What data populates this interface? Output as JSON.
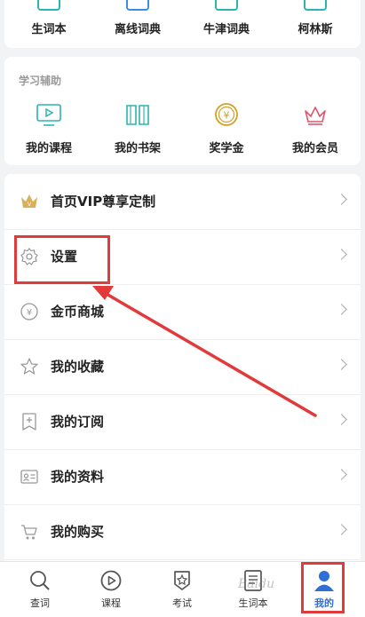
{
  "top_tools": [
    {
      "label": "生词本",
      "icon": "vocab-book-icon"
    },
    {
      "label": "离线词典",
      "icon": "offline-dict-icon"
    },
    {
      "label": "牛津词典",
      "icon": "oxford-dict-icon"
    },
    {
      "label": "柯林斯",
      "icon": "collins-dict-icon"
    }
  ],
  "study": {
    "title": "学习辅助",
    "items": [
      {
        "label": "我的课程",
        "icon": "video-course-icon"
      },
      {
        "label": "我的书架",
        "icon": "bookshelf-icon"
      },
      {
        "label": "奖学金",
        "icon": "coin-yen-icon"
      },
      {
        "label": "我的会员",
        "icon": "crown-icon"
      }
    ]
  },
  "menu": [
    {
      "label": "首页VIP尊享定制",
      "icon": "vip-crown-icon"
    },
    {
      "label": "设置",
      "icon": "settings-gear-icon"
    },
    {
      "label": "金币商城",
      "icon": "coin-icon"
    },
    {
      "label": "我的收藏",
      "icon": "star-icon"
    },
    {
      "label": "我的订阅",
      "icon": "subscribe-icon"
    },
    {
      "label": "我的资料",
      "icon": "profile-card-icon"
    },
    {
      "label": "我的购买",
      "icon": "cart-icon"
    }
  ],
  "bottom_nav": [
    {
      "label": "查词",
      "icon": "search-icon"
    },
    {
      "label": "课程",
      "icon": "play-icon"
    },
    {
      "label": "考试",
      "icon": "exam-shield-icon"
    },
    {
      "label": "生词本",
      "icon": "wordbook-icon"
    },
    {
      "label": "我的",
      "icon": "user-icon",
      "active": true
    }
  ],
  "colors": {
    "accent": "#2f6fd6",
    "teal": "#2bb5b0",
    "highlight": "#e03a3a",
    "gold": "#d4a024",
    "pink": "#e2546a"
  },
  "watermark": "Baidu"
}
